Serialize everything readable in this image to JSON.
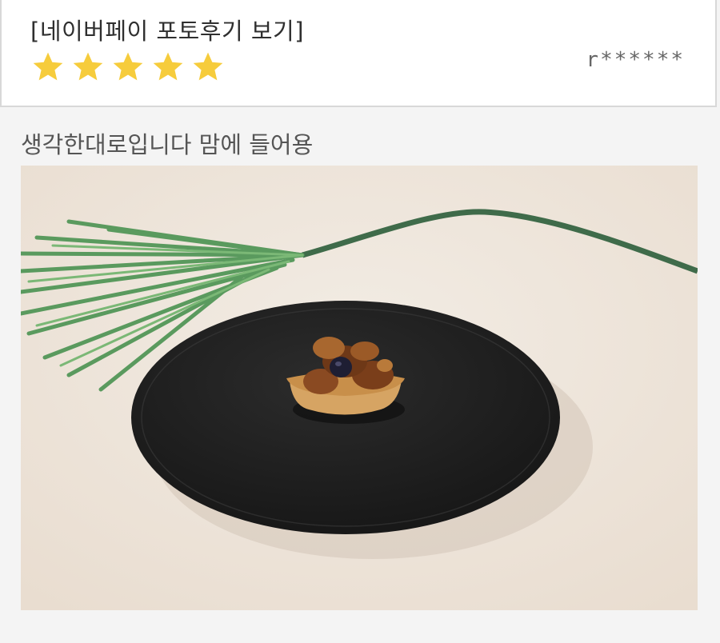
{
  "review": {
    "source_label": "[네이버페이 포토후기 보기]",
    "rating": 5,
    "rating_max": 5,
    "reviewer_name": "r******",
    "text": "생각한대로입니다 맘에 들어용",
    "star_color": "#f6cc3c",
    "photo_icon": "review-photo-icon"
  }
}
